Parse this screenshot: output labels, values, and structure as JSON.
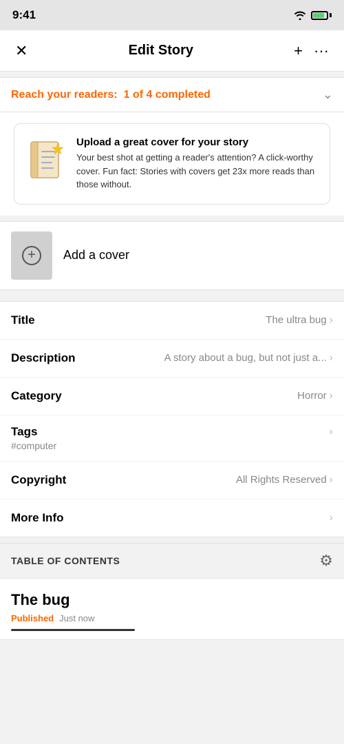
{
  "statusBar": {
    "time": "9:41",
    "wifi": "wifi",
    "battery": "battery"
  },
  "header": {
    "title": "Edit Story",
    "closeLabel": "✕",
    "addLabel": "+",
    "moreLabel": "···"
  },
  "readersBanner": {
    "prefix": "Reach your readers:",
    "highlight": "1 of 4 completed"
  },
  "tipCard": {
    "title": "Upload a great cover for your story",
    "body": "Your best shot at getting a reader's attention? A click-worthy cover. Fun fact: Stories with covers get 23x more reads than those without."
  },
  "coverSection": {
    "label": "Add a cover"
  },
  "settingsRows": [
    {
      "label": "Title",
      "value": "The ultra bug",
      "hasChevron": true
    },
    {
      "label": "Description",
      "value": "A story about a bug, but not just a...",
      "hasChevron": true
    },
    {
      "label": "Category",
      "value": "Horror",
      "hasChevron": true
    }
  ],
  "tagsRow": {
    "label": "Tags",
    "tag": "#computer",
    "hasChevron": true
  },
  "copyrightRow": {
    "label": "Copyright",
    "value": "All Rights Reserved",
    "hasChevron": true
  },
  "moreInfoRow": {
    "label": "More Info",
    "hasChevron": true
  },
  "tableOfContents": {
    "title": "TABLE OF CONTENTS"
  },
  "storyEntry": {
    "title": "The bug",
    "status": "Published",
    "time": "Just now"
  }
}
